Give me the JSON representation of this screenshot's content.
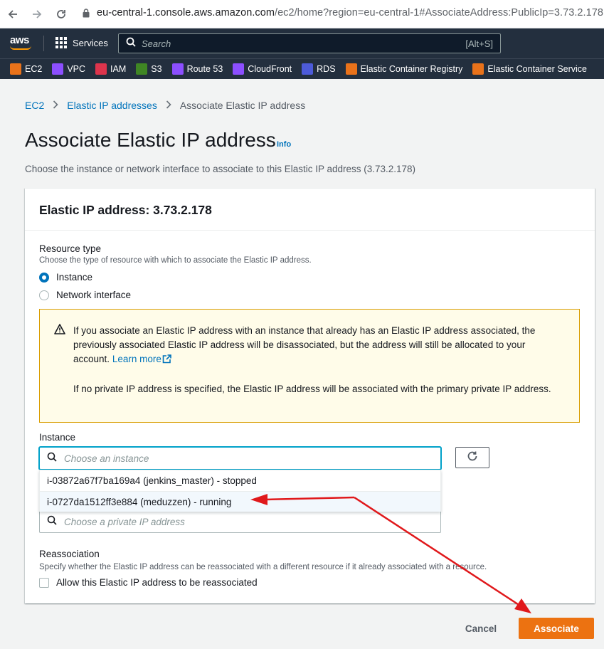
{
  "browser": {
    "url_host": "eu-central-1.console.aws.amazon.com",
    "url_path": "/ec2/home?region=eu-central-1#AssociateAddress:PublicIp=3.73.2.178"
  },
  "aws_nav": {
    "logo": "aws",
    "services_label": "Services",
    "search_placeholder": "Search",
    "search_shortcut": "[Alt+S]"
  },
  "favorites": [
    {
      "label": "EC2",
      "color": "#e9721a"
    },
    {
      "label": "VPC",
      "color": "#8c4fff"
    },
    {
      "label": "IAM",
      "color": "#dd344c"
    },
    {
      "label": "S3",
      "color": "#3f8624"
    },
    {
      "label": "Route 53",
      "color": "#8c4fff"
    },
    {
      "label": "CloudFront",
      "color": "#8c4fff"
    },
    {
      "label": "RDS",
      "color": "#4d5bd9"
    },
    {
      "label": "Elastic Container Registry",
      "color": "#e9721a"
    },
    {
      "label": "Elastic Container Service",
      "color": "#e9721a"
    }
  ],
  "breadcrumb": {
    "ec2": "EC2",
    "eips": "Elastic IP addresses",
    "current": "Associate Elastic IP address"
  },
  "page": {
    "title": "Associate Elastic IP address",
    "info": "Info",
    "description": "Choose the instance or network interface to associate to this Elastic IP address (3.73.2.178)"
  },
  "panel": {
    "title": "Elastic IP address: 3.73.2.178",
    "resource_type_label": "Resource type",
    "resource_type_desc": "Choose the type of resource with which to associate the Elastic IP address.",
    "opt_instance": "Instance",
    "opt_network_interface": "Network interface",
    "alert_p1_before": "If you associate an Elastic IP address with an instance that already has an Elastic IP address associated, the previously associated Elastic IP address will be disassociated, but the address will still be allocated to your account.",
    "alert_learn_more": "Learn more",
    "alert_p2": "If no private IP address is specified, the Elastic IP address will be associated with the primary private IP address.",
    "instance_label": "Instance",
    "instance_placeholder": "Choose an instance",
    "instance_options": [
      "i-03872a67f7ba169a4 (jenkins_master) - stopped",
      "i-0727da1512ff3e884 (meduzzen) - running"
    ],
    "private_ip_placeholder": "Choose a private IP address",
    "reassociation_label": "Reassociation",
    "reassociation_desc": "Specify whether the Elastic IP address can be reassociated with a different resource if it already associated with a resource.",
    "reassociation_checkbox": "Allow this Elastic IP address to be reassociated"
  },
  "actions": {
    "cancel": "Cancel",
    "associate": "Associate"
  },
  "colors": {
    "primary_button": "#ec7211",
    "link": "#0073bb",
    "annotation_arrow": "#e0181b"
  }
}
